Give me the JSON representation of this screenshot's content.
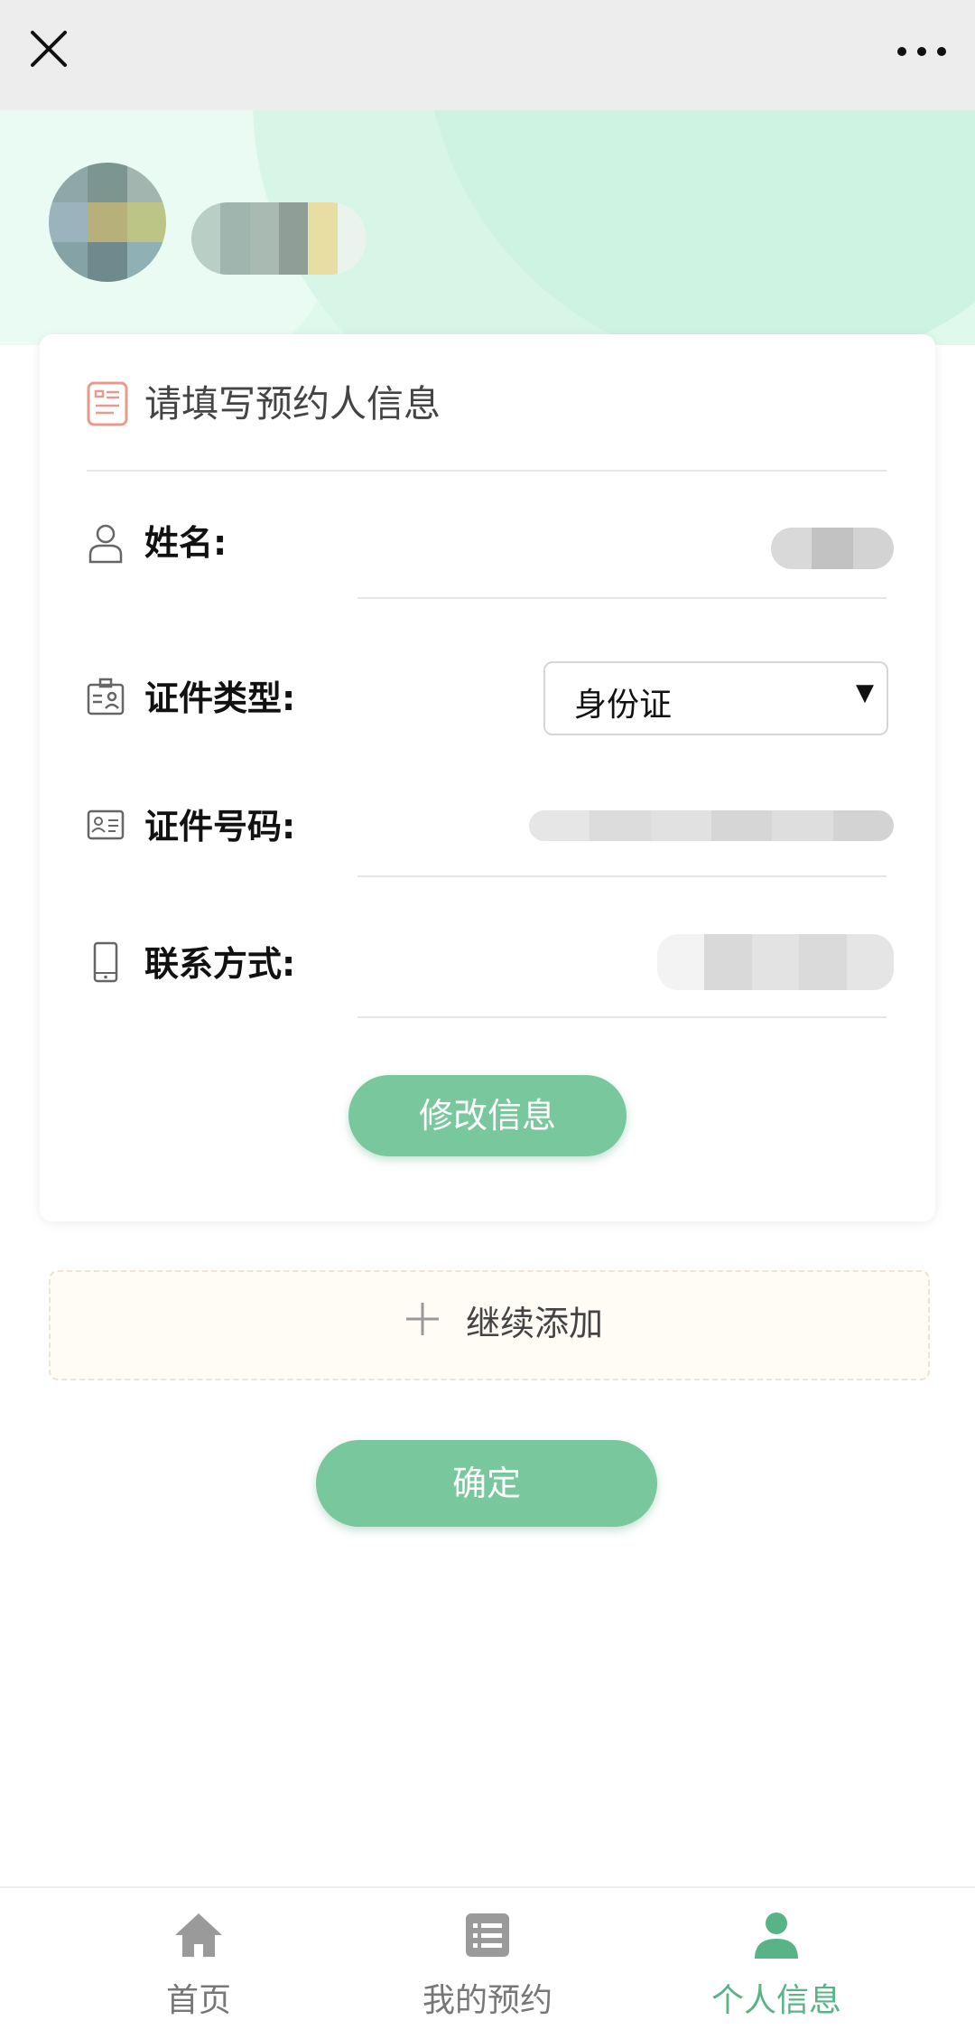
{
  "topbar": {
    "close_icon": "close-icon",
    "more_icon": "more-dots-icon"
  },
  "profile": {
    "avatar": "pixelated-avatar",
    "nickname_blurred": true
  },
  "card": {
    "title": "请填写预约人信息",
    "title_icon": "form-icon",
    "fields": [
      {
        "label": "姓名:",
        "icon": "person-icon",
        "value_blurred": true
      },
      {
        "label": "证件类型:",
        "icon": "id-card-icon",
        "select_value": "身份证"
      },
      {
        "label": "证件号码:",
        "icon": "card-icon",
        "value_blurred": true
      },
      {
        "label": "联系方式:",
        "icon": "phone-icon",
        "value_blurred": true
      }
    ],
    "modify_button": "修改信息"
  },
  "add_more": {
    "label": "继续添加",
    "icon": "plus-icon"
  },
  "confirm_button": "确定",
  "bottom_nav": [
    {
      "label": "首页",
      "icon": "home-icon",
      "active": false
    },
    {
      "label": "我的预约",
      "icon": "list-icon",
      "active": false
    },
    {
      "label": "个人信息",
      "icon": "user-icon",
      "active": true
    }
  ],
  "colors": {
    "accent": "#79c79c",
    "active_tab": "#58b486",
    "hero_bg": "#dff9ec"
  }
}
